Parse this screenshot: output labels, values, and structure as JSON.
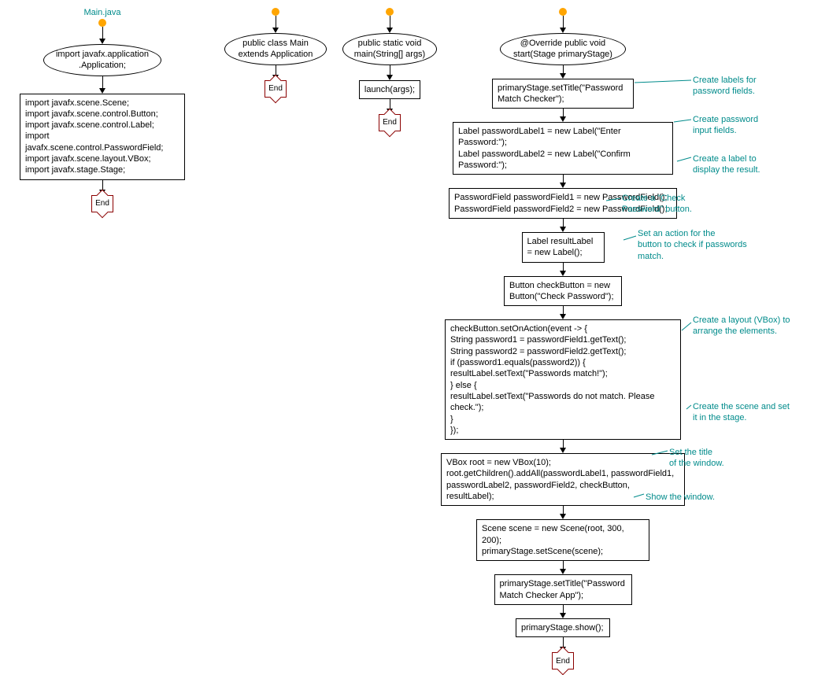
{
  "col1": {
    "title": "Main.java",
    "ellipse": "import javafx.application\n.Application;",
    "imports": "import javafx.scene.Scene;\nimport javafx.scene.control.Button;\nimport javafx.scene.control.Label;\nimport javafx.scene.control.PasswordField;\nimport javafx.scene.layout.VBox;\nimport javafx.stage.Stage;",
    "end": "End"
  },
  "col2": {
    "ellipse": "public class Main\nextends Application",
    "end": "End"
  },
  "col3": {
    "ellipse": "public static void\nmain(String[] args)",
    "box": "launch(args);",
    "end": "End"
  },
  "col4": {
    "ellipse": "@Override public void\nstart(Stage primaryStage)",
    "box1": "primaryStage.setTitle(\"Password\nMatch Checker\");",
    "box2": "Label passwordLabel1 = new Label(\"Enter Password:\");\nLabel passwordLabel2 = new Label(\"Confirm Password:\");",
    "box3": "PasswordField passwordField1 = new PasswordField();\nPasswordField passwordField2 = new PasswordField();",
    "box4": "Label resultLabel\n= new Label();",
    "box5": "Button checkButton = new\nButton(\"Check Password\");",
    "box6": "checkButton.setOnAction(event -> {\n String password1 = passwordField1.getText();\n String password2 = passwordField2.getText();\n if (password1.equals(password2)) {\n  resultLabel.setText(\"Passwords match!\");\n  } else {\n   resultLabel.setText(\"Passwords do not match. Please\ncheck.\");\n }\n });",
    "box7": "VBox root = new VBox(10);\nroot.getChildren().addAll(passwordLabel1, passwordField1,\npasswordLabel2, passwordField2, checkButton, resultLabel);",
    "box8": "Scene scene = new Scene(root, 300, 200);\nprimaryStage.setScene(scene);",
    "box9": "primaryStage.setTitle(\"Password\nMatch Checker App\");",
    "box10": "primaryStage.show();",
    "end": "End"
  },
  "annotations": {
    "a1": "Create labels for\npassword fields.",
    "a2": "Create password\ninput fields.",
    "a3": "Create a label to\ndisplay the result.",
    "a4": "Create a \"Check\nPassword\" button.",
    "a5": "Set an action for the\nbutton to check if passwords\nmatch.",
    "a6": "Create a layout (VBox) to\narrange the elements.",
    "a7": "Create the scene and set\nit in the stage.",
    "a8": "Set the title\nof the window.",
    "a9": "Show the window."
  }
}
